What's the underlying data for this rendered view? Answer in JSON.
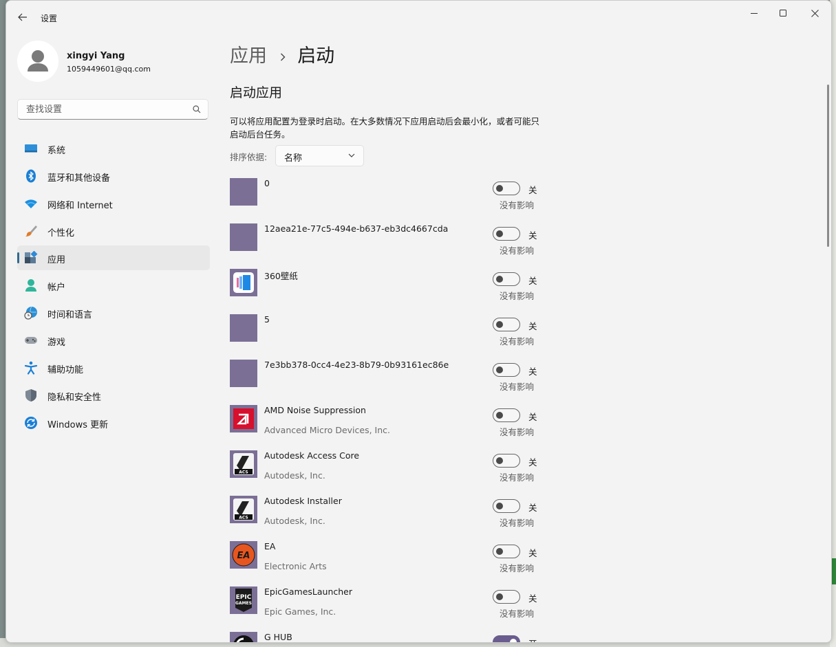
{
  "window": {
    "title": "设置"
  },
  "profile": {
    "name": "xingyi Yang",
    "email": "1059449601@qq.com"
  },
  "search": {
    "placeholder": "查找设置"
  },
  "sidebar": {
    "items": [
      {
        "label": "系统",
        "icon": "system-icon"
      },
      {
        "label": "蓝牙和其他设备",
        "icon": "bluetooth-icon"
      },
      {
        "label": "网络和 Internet",
        "icon": "wifi-icon"
      },
      {
        "label": "个性化",
        "icon": "brush-icon"
      },
      {
        "label": "应用",
        "icon": "apps-icon",
        "selected": true
      },
      {
        "label": "帐户",
        "icon": "account-icon"
      },
      {
        "label": "时间和语言",
        "icon": "globe-clock-icon"
      },
      {
        "label": "游戏",
        "icon": "gamepad-icon"
      },
      {
        "label": "辅助功能",
        "icon": "accessibility-icon"
      },
      {
        "label": "隐私和安全性",
        "icon": "shield-icon"
      },
      {
        "label": "Windows 更新",
        "icon": "update-icon"
      }
    ]
  },
  "breadcrumb": {
    "parent": "应用",
    "current": "启动"
  },
  "section": {
    "title": "启动应用",
    "description": "可以将应用配置为登录时启动。在大多数情况下应用启动后会最小化，或者可能只启动后台任务。"
  },
  "sort": {
    "label": "排序依据:",
    "value": "名称"
  },
  "apps": [
    {
      "name": "0",
      "publisher": "",
      "state": "关",
      "on": false,
      "impact": "没有影响",
      "icon": "blank-app-icon"
    },
    {
      "name": "12aea21e-77c5-494e-b637-eb3dc4667cda",
      "publisher": "",
      "state": "关",
      "on": false,
      "impact": "没有影响",
      "icon": "blank-app-icon"
    },
    {
      "name": "360壁纸",
      "publisher": "",
      "state": "关",
      "on": false,
      "impact": "没有影响",
      "icon": "wallpaper-icon"
    },
    {
      "name": "5",
      "publisher": "",
      "state": "关",
      "on": false,
      "impact": "没有影响",
      "icon": "blank-app-icon"
    },
    {
      "name": "7e3bb378-0cc4-4e23-8b79-0b93161ec86e",
      "publisher": "",
      "state": "关",
      "on": false,
      "impact": "没有影响",
      "icon": "blank-app-icon"
    },
    {
      "name": "AMD Noise Suppression",
      "publisher": "Advanced Micro Devices, Inc.",
      "state": "关",
      "on": false,
      "impact": "没有影响",
      "icon": "amd-icon"
    },
    {
      "name": "Autodesk Access Core",
      "publisher": "Autodesk, Inc.",
      "state": "关",
      "on": false,
      "impact": "没有影响",
      "icon": "autodesk-icon"
    },
    {
      "name": "Autodesk Installer",
      "publisher": "Autodesk, Inc.",
      "state": "关",
      "on": false,
      "impact": "没有影响",
      "icon": "autodesk-icon"
    },
    {
      "name": "EA",
      "publisher": "Electronic Arts",
      "state": "关",
      "on": false,
      "impact": "没有影响",
      "icon": "ea-icon"
    },
    {
      "name": "EpicGamesLauncher",
      "publisher": "Epic Games, Inc.",
      "state": "关",
      "on": false,
      "impact": "没有影响",
      "icon": "epic-icon"
    },
    {
      "name": "G HUB",
      "publisher": "",
      "state": "开",
      "on": true,
      "impact": "",
      "icon": "ghub-icon"
    }
  ],
  "colors": {
    "accent": "#6a5c8e",
    "selected_bg": "#e8e8e8",
    "app_tile": "#7b6f96"
  }
}
